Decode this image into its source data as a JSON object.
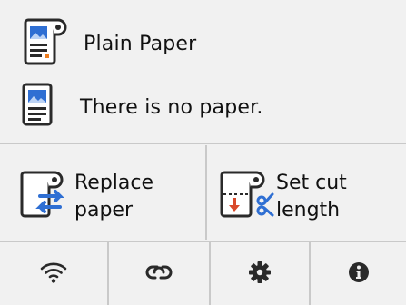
{
  "paper_info": {
    "paper_type": "Plain Paper",
    "paper_status": "There is no paper."
  },
  "buttons": {
    "replace_paper": {
      "line1": "Replace",
      "line2": "paper",
      "icon": "replace-paper-icon"
    },
    "set_cut_length": {
      "line1": "Set cut",
      "line2": "length",
      "icon": "cut-length-icon"
    }
  },
  "bottom_bar": [
    {
      "icon": "wifi-icon"
    },
    {
      "icon": "link-icon"
    },
    {
      "icon": "gear-icon"
    },
    {
      "icon": "info-icon"
    }
  ],
  "colors": {
    "accent_blue": "#2f6fd3",
    "accent_orange": "#ee7d1f",
    "accent_red": "#d94a2b",
    "icon_dark": "#2a2a2a",
    "divider": "#c9c9c9",
    "background": "#f1f1f1"
  }
}
